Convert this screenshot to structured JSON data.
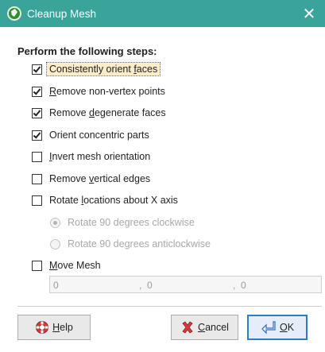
{
  "window": {
    "title": "Cleanup Mesh",
    "close_glyph": "✕",
    "titlebar_color": "#3aa39a"
  },
  "heading": "Perform the following steps:",
  "steps": [
    {
      "pre": "Consistently orient ",
      "acc": "f",
      "post": "aces",
      "checked": true
    },
    {
      "pre": "",
      "acc": "R",
      "post": "emove non-vertex points",
      "checked": true
    },
    {
      "pre": "Remove ",
      "acc": "d",
      "post": "egenerate faces",
      "checked": true
    },
    {
      "pre": "Orient concentric parts",
      "acc": "",
      "post": "",
      "checked": true
    },
    {
      "pre": "",
      "acc": "I",
      "post": "nvert mesh orientation",
      "checked": false
    },
    {
      "pre": "Remove ",
      "acc": "v",
      "post": "ertical edges",
      "checked": false
    },
    {
      "pre": "Rotate ",
      "acc": "l",
      "post": "ocations about X axis",
      "checked": false
    }
  ],
  "rotation_options": [
    {
      "label": "Rotate 90 degrees clockwise",
      "selected": true
    },
    {
      "label": "Rotate 90 degrees anticlockwise",
      "selected": false
    }
  ],
  "move_mesh": {
    "pre": "",
    "acc": "M",
    "post": "ove Mesh",
    "checked": false
  },
  "coordinates": {
    "x": "0",
    "y": "0",
    "z": "0",
    "sep": ","
  },
  "buttons": {
    "help": {
      "acc": "H",
      "post": "elp"
    },
    "cancel": {
      "acc": "C",
      "post": "ancel"
    },
    "ok": {
      "acc": "O",
      "post": "K"
    }
  },
  "icons": {
    "app": "app-logo-icon",
    "help": "help-lifebuoy-icon",
    "cancel": "cancel-x-icon",
    "ok": "ok-enter-arrow-icon"
  }
}
